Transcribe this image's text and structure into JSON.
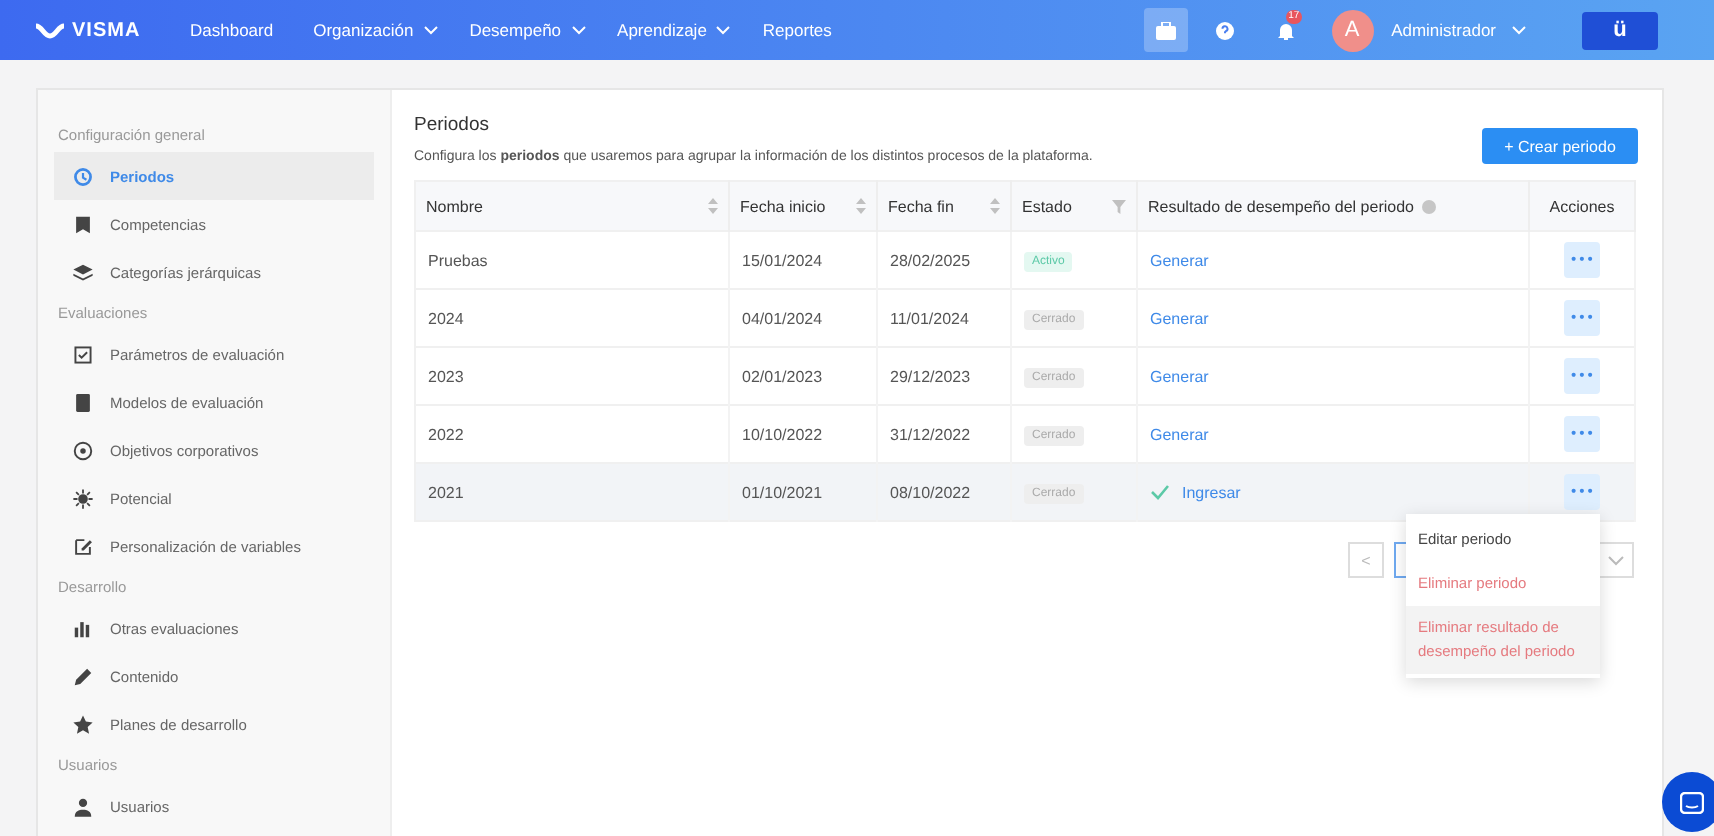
{
  "navbar": {
    "brand": "VISMA",
    "items": [
      {
        "label": "Dashboard",
        "dropdown": false
      },
      {
        "label": "Organización",
        "dropdown": true
      },
      {
        "label": "Desempeño",
        "dropdown": true
      },
      {
        "label": "Aprendizaje",
        "dropdown": true
      },
      {
        "label": "Reportes",
        "dropdown": false
      }
    ],
    "notifications": "17",
    "avatar": "A",
    "user": "Administrador",
    "app_button": "ü"
  },
  "sidebar": {
    "sections": [
      {
        "title": "Configuración general",
        "items": [
          {
            "label": "Periodos",
            "selected": true
          },
          {
            "label": "Competencias",
            "selected": false
          },
          {
            "label": "Categorías jerárquicas",
            "selected": false
          }
        ]
      },
      {
        "title": "Evaluaciones",
        "items": [
          {
            "label": "Parámetros de evaluación",
            "selected": false
          },
          {
            "label": "Modelos de evaluación",
            "selected": false
          },
          {
            "label": "Objetivos corporativos",
            "selected": false
          },
          {
            "label": "Potencial",
            "selected": false
          },
          {
            "label": "Personalización de variables",
            "selected": false
          }
        ]
      },
      {
        "title": "Desarrollo",
        "items": [
          {
            "label": "Otras evaluaciones",
            "selected": false
          },
          {
            "label": "Contenido",
            "selected": false
          },
          {
            "label": "Planes de desarrollo",
            "selected": false
          }
        ]
      },
      {
        "title": "Usuarios",
        "items": [
          {
            "label": "Usuarios",
            "selected": false
          }
        ]
      }
    ]
  },
  "page": {
    "title": "Periodos",
    "description": "Configura los **periodos** que usaremos para agrupar la información de los distintos procesos de la plataforma.",
    "create_button": "+ Crear periodo"
  },
  "table": {
    "columns": [
      {
        "label": "Nombre",
        "kind": "sort"
      },
      {
        "label": "Fecha inicio",
        "kind": "sort"
      },
      {
        "label": "Fecha fin",
        "kind": "sort"
      },
      {
        "label": "Estado",
        "kind": "filter"
      },
      {
        "label": "Resultado de desempeño del periodo",
        "kind": "info"
      },
      {
        "label": "Acciones",
        "kind": "plain"
      }
    ],
    "rows": [
      {
        "name": "Pruebas",
        "start": "15/01/2024",
        "end": "28/02/2025",
        "status": {
          "label": "Activo",
          "kind": "active"
        },
        "result": {
          "label": "Generar",
          "done": false
        },
        "actions": "•••",
        "hovered": false
      },
      {
        "name": "2024",
        "start": "04/01/2024",
        "end": "11/01/2024",
        "status": {
          "label": "Cerrado",
          "kind": "closed"
        },
        "result": {
          "label": "Generar",
          "done": false
        },
        "actions": "•••",
        "hovered": false
      },
      {
        "name": "2023",
        "start": "02/01/2023",
        "end": "29/12/2023",
        "status": {
          "label": "Cerrado",
          "kind": "closed"
        },
        "result": {
          "label": "Generar",
          "done": false
        },
        "actions": "•••",
        "hovered": false
      },
      {
        "name": "2022",
        "start": "10/10/2022",
        "end": "31/12/2022",
        "status": {
          "label": "Cerrado",
          "kind": "closed"
        },
        "result": {
          "label": "Generar",
          "done": false
        },
        "actions": "•••",
        "hovered": false
      },
      {
        "name": "2021",
        "start": "01/10/2021",
        "end": "08/10/2022",
        "status": {
          "label": "Cerrado",
          "kind": "closed"
        },
        "result": {
          "label": "Ingresar",
          "done": true
        },
        "actions": "•••",
        "hovered": true
      }
    ]
  },
  "pagination": {
    "prev": "<"
  },
  "action_menu": {
    "items": [
      {
        "label": "Editar periodo",
        "kind": "normal",
        "hovered": false
      },
      {
        "label": "Eliminar periodo",
        "kind": "danger",
        "hovered": false
      },
      {
        "label": "Eliminar resultado de desempeño del periodo",
        "kind": "danger",
        "hovered": true
      }
    ]
  }
}
